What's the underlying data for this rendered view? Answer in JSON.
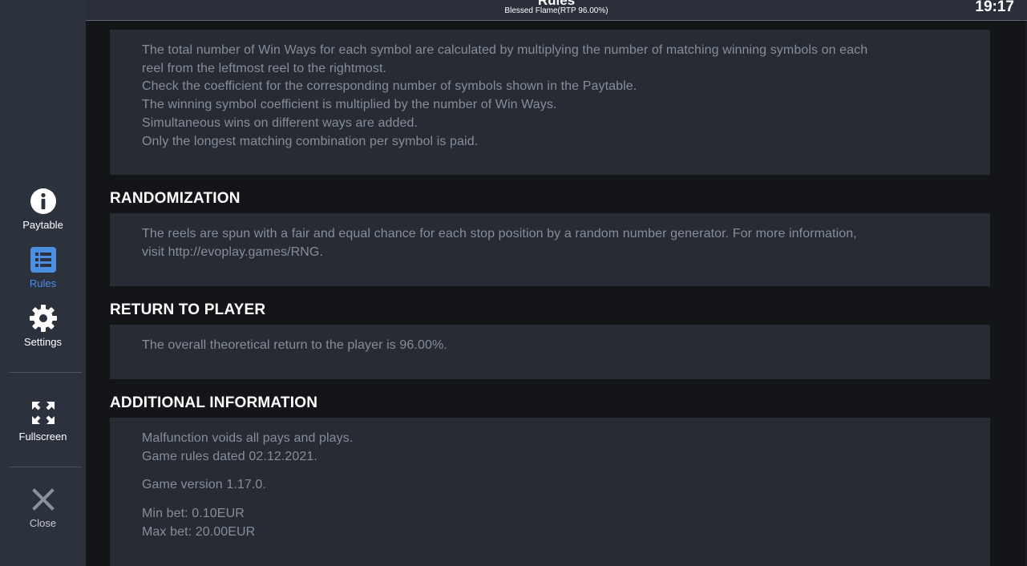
{
  "header": {
    "title": "Rules",
    "subtitle": "Blessed Flame(RTP 96.00%)",
    "clock": "19:17"
  },
  "sidebar": {
    "items": [
      {
        "label": "Paytable",
        "icon": "info-icon"
      },
      {
        "label": "Rules",
        "icon": "list-icon",
        "active": true
      },
      {
        "label": "Settings",
        "icon": "gear-icon"
      },
      {
        "label": "Fullscreen",
        "icon": "fullscreen-icon"
      },
      {
        "label": "Close",
        "icon": "close-icon"
      }
    ],
    "active_color": "#4a8fe0"
  },
  "sections": {
    "ways": {
      "lines": [
        "The total number of Win Ways for each symbol are calculated by multiplying the number of matching winning symbols on each",
        "reel from the leftmost reel to the rightmost.",
        "Check the coefficient for the corresponding number of symbols shown in the Paytable.",
        "The winning symbol coefficient is multiplied by the number of Win Ways.",
        "Simultaneous wins on different ways are added.",
        "Only the longest matching combination per symbol is paid."
      ]
    },
    "randomization": {
      "title": "RANDOMIZATION",
      "lines": [
        "The reels are spun with a fair and equal chance for each stop position by a random number generator. For more information,",
        "visit http://evoplay.games/RNG."
      ]
    },
    "rtp": {
      "title": "RETURN TO PLAYER",
      "lines": [
        "The overall theoretical return to the player is 96.00%."
      ]
    },
    "additional": {
      "title": "ADDITIONAL INFORMATION",
      "lines": [
        "Malfunction voids all pays and plays.",
        "Game rules dated 02.12.2021.",
        "Game version 1.17.0.",
        "Min bet: 0.10EUR",
        "Max bet: 20.00EUR"
      ]
    }
  }
}
